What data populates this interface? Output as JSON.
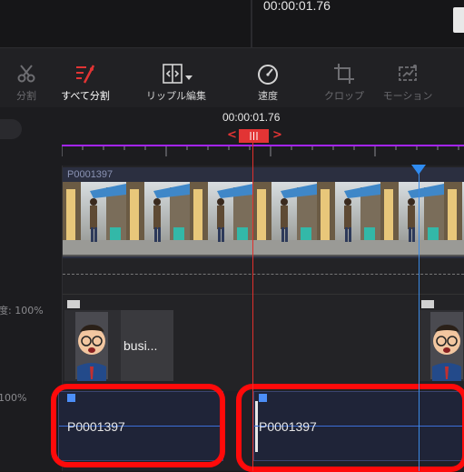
{
  "preview": {
    "timecode": "00:00:01.76"
  },
  "toolbar": {
    "items": [
      {
        "label": "分割",
        "icon": "scissors-icon",
        "state": "disabled"
      },
      {
        "label": "すべて分割",
        "icon": "split-all-icon",
        "state": "active"
      },
      {
        "label": "リップル編集",
        "icon": "ripple-edit-icon",
        "state": "normal"
      },
      {
        "label": "速度",
        "icon": "speed-icon",
        "state": "normal"
      },
      {
        "label": "クロップ",
        "icon": "crop-icon",
        "state": "disabled"
      },
      {
        "label": "モーション",
        "icon": "motion-icon",
        "state": "disabled"
      }
    ]
  },
  "timeline": {
    "current_time": "00:00:01.76",
    "marker_icon": "playhead-marker-icon",
    "video_clip": {
      "label": "P0001397"
    },
    "image_clip": {
      "label": "busi..."
    },
    "opacity_labels": [
      "度: 100%",
      "100%"
    ],
    "audio_clips": [
      {
        "label": "P0001397"
      },
      {
        "label": "P0001397"
      }
    ]
  },
  "colors": {
    "accent_red": "#e23434",
    "ruler_purple": "#a524ff",
    "playhead_blue": "#2f8cf2",
    "highlight_red": "#ff0a0a"
  }
}
